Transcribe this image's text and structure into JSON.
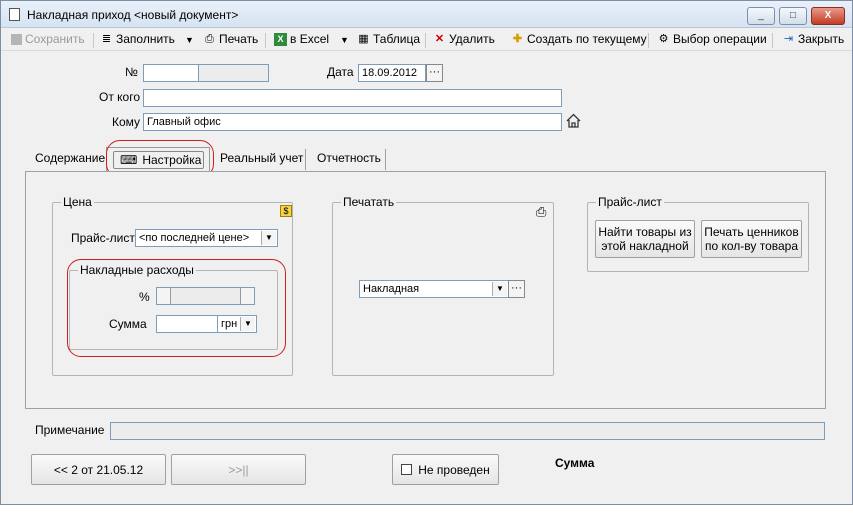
{
  "window": {
    "title": "Накладная приход <новый документ>",
    "min_glyph": "_",
    "max_glyph": "□",
    "close_glyph": "X"
  },
  "toolbar": {
    "save": "Сохранить",
    "fill": "Заполнить",
    "print": "Печать",
    "excel": "в Excel",
    "table": "Таблица",
    "delete": "Удалить",
    "create_from_current": "Создать по текущему",
    "select_operation": "Выбор операции",
    "close": "Закрыть",
    "dropdown_glyph": "▼"
  },
  "header": {
    "number_label": "№",
    "number_value": "",
    "date_label": "Дата",
    "date_value": "18.09.2012",
    "from_label": "От кого",
    "from_value": "",
    "to_label": "Кому",
    "to_value": "Главный офис",
    "ellipsis": "···"
  },
  "tabs": [
    {
      "label": "Содержание"
    },
    {
      "label": "Настройка"
    },
    {
      "label": "Реальный учет"
    },
    {
      "label": "Отчетность"
    }
  ],
  "price_group": {
    "title": "Цена",
    "price_list_label": "Прайс-лист",
    "price_list_value": "<по последней цене>",
    "overhead_title": "Накладные расходы",
    "percent_label": "%",
    "sum_label": "Сумма",
    "currency_value": "грн"
  },
  "print_group": {
    "title": "Печатать",
    "document_value": "Накладная"
  },
  "pricelist_group": {
    "title": "Прайс-лист",
    "find_button_line1": "Найти товары из",
    "find_button_line2": "этой накладной",
    "print_tags_line1": "Печать ценников",
    "print_tags_line2": "по кол-ву товара"
  },
  "footer": {
    "note_label": "Примечание",
    "note_value": "",
    "prev_doc": "<< 2 от 21.05.12",
    "next_doc": ">>||",
    "status": "Не проведен",
    "sum_label": "Сумма"
  },
  "colors": {
    "highlight_oval": "#cc1f1f",
    "window_bg": "#f0f0f0",
    "field_border": "#7f9db9"
  }
}
